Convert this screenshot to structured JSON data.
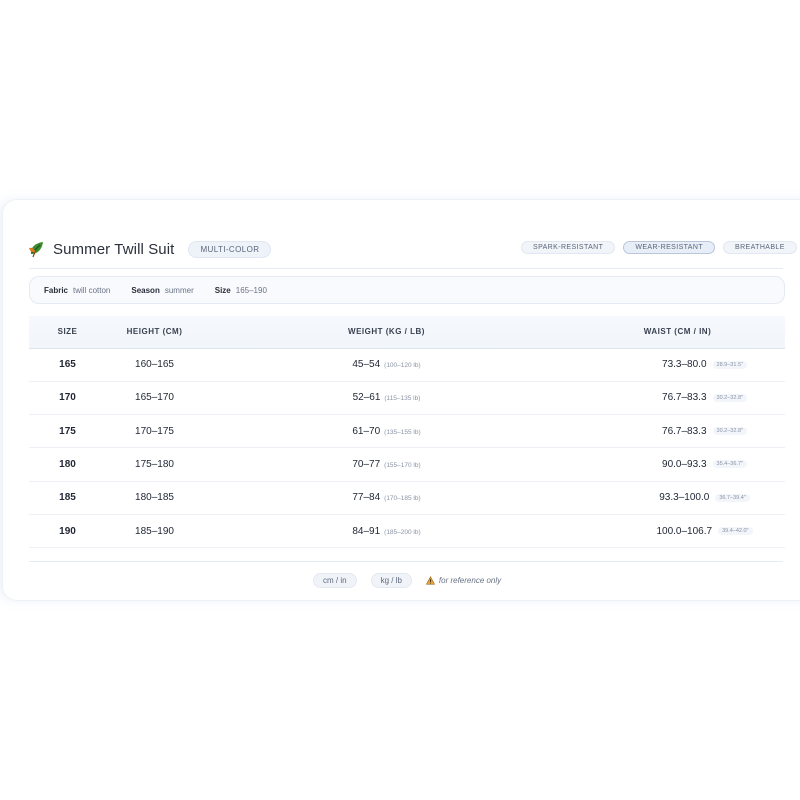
{
  "header": {
    "title": "Summer Twill Suit",
    "variant": "MULTI-COLOR",
    "tags": [
      {
        "label": "SPARK-RESISTANT",
        "active": false
      },
      {
        "label": "WEAR-RESISTANT",
        "active": true
      },
      {
        "label": "BREATHABLE",
        "active": false
      }
    ],
    "icons": {
      "logo": "leaf-logo-icon"
    }
  },
  "meta": {
    "fabric_label": "Fabric",
    "fabric_value": "twill cotton",
    "season_label": "Season",
    "season_value": "summer",
    "size_label": "Size",
    "size_value": "165–190"
  },
  "table": {
    "columns": [
      "SIZE",
      "HEIGHT (CM)",
      "WEIGHT (KG / LB)",
      "WAIST (CM / IN)"
    ],
    "rows": [
      {
        "size": "165",
        "height": "160–165",
        "weight": "45–54",
        "weight_lb": "(100–120 lb)",
        "waist": "73.3–80.0",
        "waist_in": "28.9–31.5\""
      },
      {
        "size": "170",
        "height": "165–170",
        "weight": "52–61",
        "weight_lb": "(115–135 lb)",
        "waist": "76.7–83.3",
        "waist_in": "30.2–32.8\""
      },
      {
        "size": "175",
        "height": "170–175",
        "weight": "61–70",
        "weight_lb": "(135–155 lb)",
        "waist": "76.7–83.3",
        "waist_in": "30.2–32.8\""
      },
      {
        "size": "180",
        "height": "175–180",
        "weight": "70–77",
        "weight_lb": "(155–170 lb)",
        "waist": "90.0–93.3",
        "waist_in": "35.4–36.7\""
      },
      {
        "size": "185",
        "height": "180–185",
        "weight": "77–84",
        "weight_lb": "(170–185 lb)",
        "waist": "93.3–100.0",
        "waist_in": "36.7–39.4\""
      },
      {
        "size": "190",
        "height": "185–190",
        "weight": "84–91",
        "weight_lb": "(185–200 lb)",
        "waist": "100.0–106.7",
        "waist_in": "39.4–42.0\""
      }
    ]
  },
  "footer": {
    "unit_length": "cm / in",
    "unit_weight": "kg / lb",
    "note": "for reference only",
    "icons": {
      "note": "warning-icon"
    }
  },
  "colors": {
    "accent_pill": "#eef3fa",
    "text": "#222836",
    "muted": "#8a93a4",
    "logo_green": "#3b8a2e",
    "logo_orange": "#e0781e"
  }
}
